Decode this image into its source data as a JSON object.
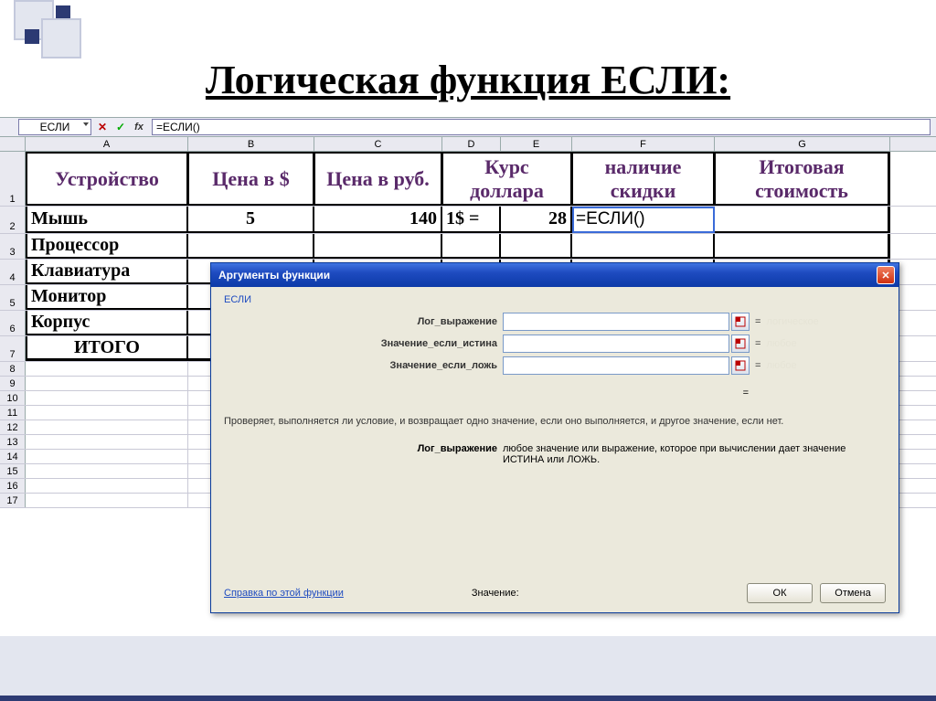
{
  "slide_title": "Логическая функция ЕСЛИ:",
  "namebox": "ЕСЛИ",
  "formula_bar": "=ЕСЛИ()",
  "columns": [
    "A",
    "B",
    "C",
    "D",
    "E",
    "F",
    "G"
  ],
  "headers": {
    "A": "Устройство",
    "B": "Цена в $",
    "C": "Цена в руб.",
    "DE": "Курс доллара",
    "F": "наличие скидки",
    "G": "Итоговая стоимость"
  },
  "rows": [
    {
      "n": "2",
      "A": "Мышь",
      "B": "5",
      "C": "140",
      "D": "1$ =",
      "E": "28",
      "F": "=ЕСЛИ()",
      "G": ""
    },
    {
      "n": "3",
      "A": "Процессор"
    },
    {
      "n": "4",
      "A": "Клавиатура"
    },
    {
      "n": "5",
      "A": "Монитор"
    },
    {
      "n": "6",
      "A": "Корпус"
    },
    {
      "n": "7",
      "A": "ИТОГО"
    }
  ],
  "thin_rows": [
    "8",
    "9",
    "10",
    "11",
    "12",
    "13",
    "14",
    "15",
    "16",
    "17"
  ],
  "dialog": {
    "title": "Аргументы функции",
    "fn": "ЕСЛИ",
    "args": [
      {
        "label": "Лог_выражение",
        "hint": "логическое"
      },
      {
        "label": "Значение_если_истина",
        "hint": "любое"
      },
      {
        "label": "Значение_если_ложь",
        "hint": "любое"
      }
    ],
    "eq_only": "=",
    "description": "Проверяет, выполняется ли условие, и возвращает одно значение, если оно выполняется, и другое значение, если нет.",
    "arg_name": "Лог_выражение",
    "arg_desc": "любое значение или выражение, которое при вычислении дает значение ИСТИНА или ЛОЖЬ.",
    "help": "Справка по этой функции",
    "value_label": "Значение:",
    "ok": "ОК",
    "cancel": "Отмена"
  }
}
